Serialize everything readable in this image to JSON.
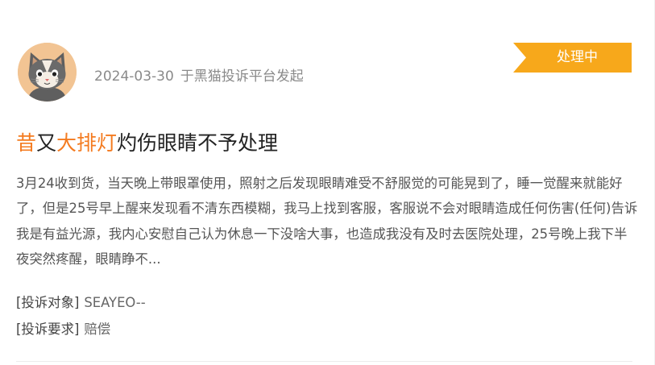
{
  "complaint": {
    "date": "2024-03-30",
    "platform_text": "于黑猫投诉平台发起",
    "status": "处理中",
    "title_parts": {
      "a": "昔",
      "b": "又",
      "c": "大排灯",
      "d": "灼伤眼睛不予处理"
    },
    "description": "3月24收到货，当天晚上带眼罩使用，照射之后发现眼睛难受不舒服觉的可能晃到了，睡一觉醒来就能好了，但是25号早上醒来发现看不清东西模糊，我马上找到客服，客服说不会对眼睛造成任何伤害(任何)告诉我是有益光源，我内心安慰自己认为休息一下没啥大事，也造成我没有及时去医院处理，25号晚上我下半夜突然疼醒，眼睛睁不...",
    "target_label": "[投诉对象]",
    "target_value": "SEAYEO--",
    "demand_label": "[投诉要求]",
    "demand_value": "赔偿"
  },
  "colors": {
    "accent": "#f47b20",
    "badge": "#f7a81b"
  },
  "icons": {
    "avatar": "cat-avatar"
  }
}
